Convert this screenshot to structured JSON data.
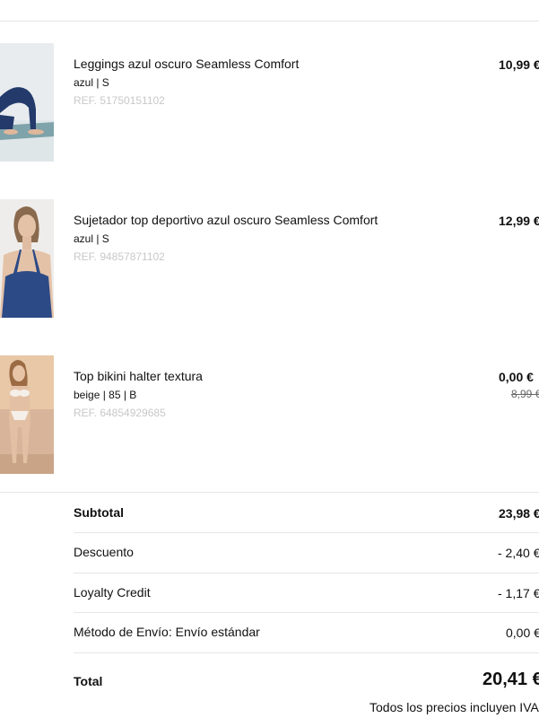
{
  "items": [
    {
      "name": "Leggings azul oscuro Seamless Comfort",
      "variant": "azul | S",
      "ref": "REF. 51750151102",
      "price": "10,99 €",
      "old_price": ""
    },
    {
      "name": "Sujetador top deportivo azul oscuro Seamless Comfort",
      "variant": "azul | S",
      "ref": "REF. 94857871102",
      "price": "12,99 €",
      "old_price": ""
    },
    {
      "name": "Top bikini halter textura",
      "variant": "beige | 85 | B",
      "ref": "REF. 64854929685",
      "price": "0,00 €",
      "old_price": "8,99 €"
    }
  ],
  "summary": {
    "subtotal_label": "Subtotal",
    "subtotal_value": "23,98 €",
    "discount_label": "Descuento",
    "discount_value": "- 2,40 €",
    "loyalty_label": "Loyalty Credit",
    "loyalty_value": "- 1,17 €",
    "shipping_label": "Método de Envío: Envío estándar",
    "shipping_value": "0,00 €",
    "total_label": "Total",
    "total_value": "20,41 €",
    "tax_note": "Todos los precios incluyen IVA"
  }
}
